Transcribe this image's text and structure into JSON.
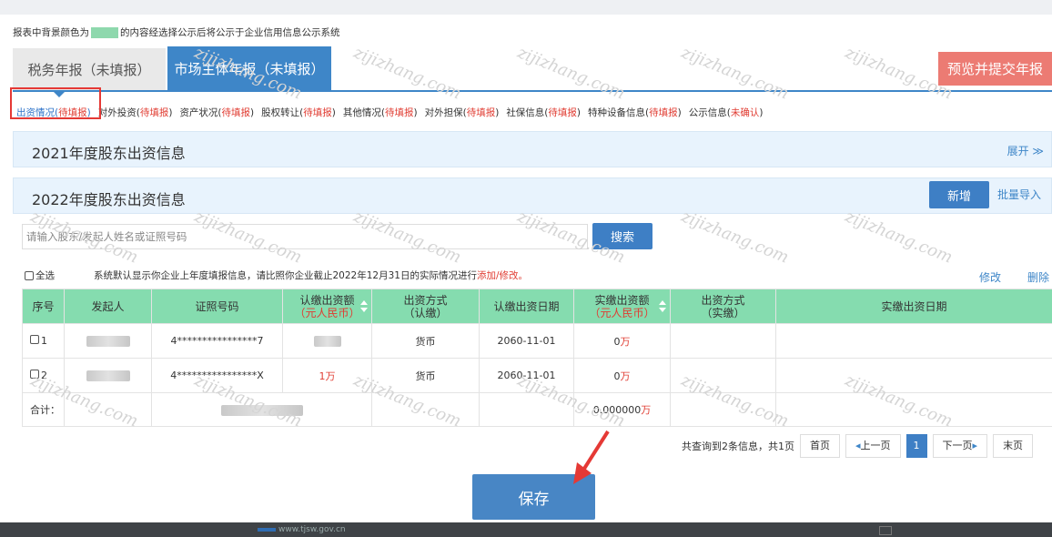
{
  "notice": {
    "prefix": "报表中背景颜色为",
    "suffix": "的内容经选择公示后将公示于企业信用信息公示系统",
    "swatch_color": "#8ed8ad"
  },
  "tabs": [
    {
      "label": "税务年报（未填报）",
      "active": false
    },
    {
      "label": "市场主体年报（未填报）",
      "active": true
    }
  ],
  "preview_button": "预览并提交年报",
  "subtabs": [
    {
      "name": "出资情况(",
      "status": "待填报",
      "close": ")"
    },
    {
      "name": "对外投资(",
      "status": "待填报",
      "close": ")"
    },
    {
      "name": "资产状况(",
      "status": "待填报",
      "close": ")"
    },
    {
      "name": "股权转让(",
      "status": "待填报",
      "close": ")"
    },
    {
      "name": "其他情况(",
      "status": "待填报",
      "close": ")"
    },
    {
      "name": "对外担保(",
      "status": "待填报",
      "close": ")"
    },
    {
      "name": "社保信息(",
      "status": "待填报",
      "close": ")"
    },
    {
      "name": "特种设备信息(",
      "status": "待填报",
      "close": ")"
    },
    {
      "name": "公示信息(",
      "status": "未确认",
      "close": ")"
    }
  ],
  "section_2021": {
    "title": "2021年度股东出资信息",
    "expand": "展开 ≫"
  },
  "section_2022": {
    "title": "2022年度股东出资信息",
    "add": "新增",
    "batch_import": "批量导入"
  },
  "search": {
    "placeholder": "请输入股东/发起人姓名或证照号码",
    "button": "搜索"
  },
  "select_all": "全选",
  "system_note": {
    "text": "系统默认显示你企业上年度填报信息，请比照你企业截止2022年12月31日的实际情况进行",
    "link": "添加/修改。"
  },
  "actions": {
    "edit": "修改",
    "delete": "删除"
  },
  "table": {
    "headers": [
      {
        "l1": "序号",
        "l2": ""
      },
      {
        "l1": "发起人",
        "l2": ""
      },
      {
        "l1": "证照号码",
        "l2": ""
      },
      {
        "l1": "认缴出资额",
        "l2": "（元人民币）"
      },
      {
        "l1": "出资方式",
        "l2": "（认缴）"
      },
      {
        "l1": "认缴出资日期",
        "l2": ""
      },
      {
        "l1": "实缴出资额",
        "l2": "（元人民币）"
      },
      {
        "l1": "出资方式",
        "l2": "（实缴）"
      },
      {
        "l1": "实缴出资日期",
        "l2": ""
      }
    ],
    "rows": [
      {
        "index": "1",
        "id_no": "4****************7",
        "sub_amount": "",
        "method": "货币",
        "sub_date": "2060-11-01",
        "paid_num": "0",
        "paid_unit": "万",
        "paid_method": "",
        "paid_date": ""
      },
      {
        "index": "2",
        "id_no": "4****************X",
        "sub_amount": "1万",
        "method": "货币",
        "sub_date": "2060-11-01",
        "paid_num": "0",
        "paid_unit": "万",
        "paid_method": "",
        "paid_date": ""
      }
    ],
    "sum": {
      "label": "合计：",
      "paid_num": "0.000000",
      "paid_unit": "万"
    }
  },
  "pager": {
    "summary": "共查询到2条信息，共1页",
    "first": "首页",
    "prev": "上一页",
    "current": "1",
    "next": "下一页",
    "last": "末页"
  },
  "save_button": "保存",
  "watermark": "zijizhang.com",
  "taskbar_text": "www.tjsw.gov.cn"
}
